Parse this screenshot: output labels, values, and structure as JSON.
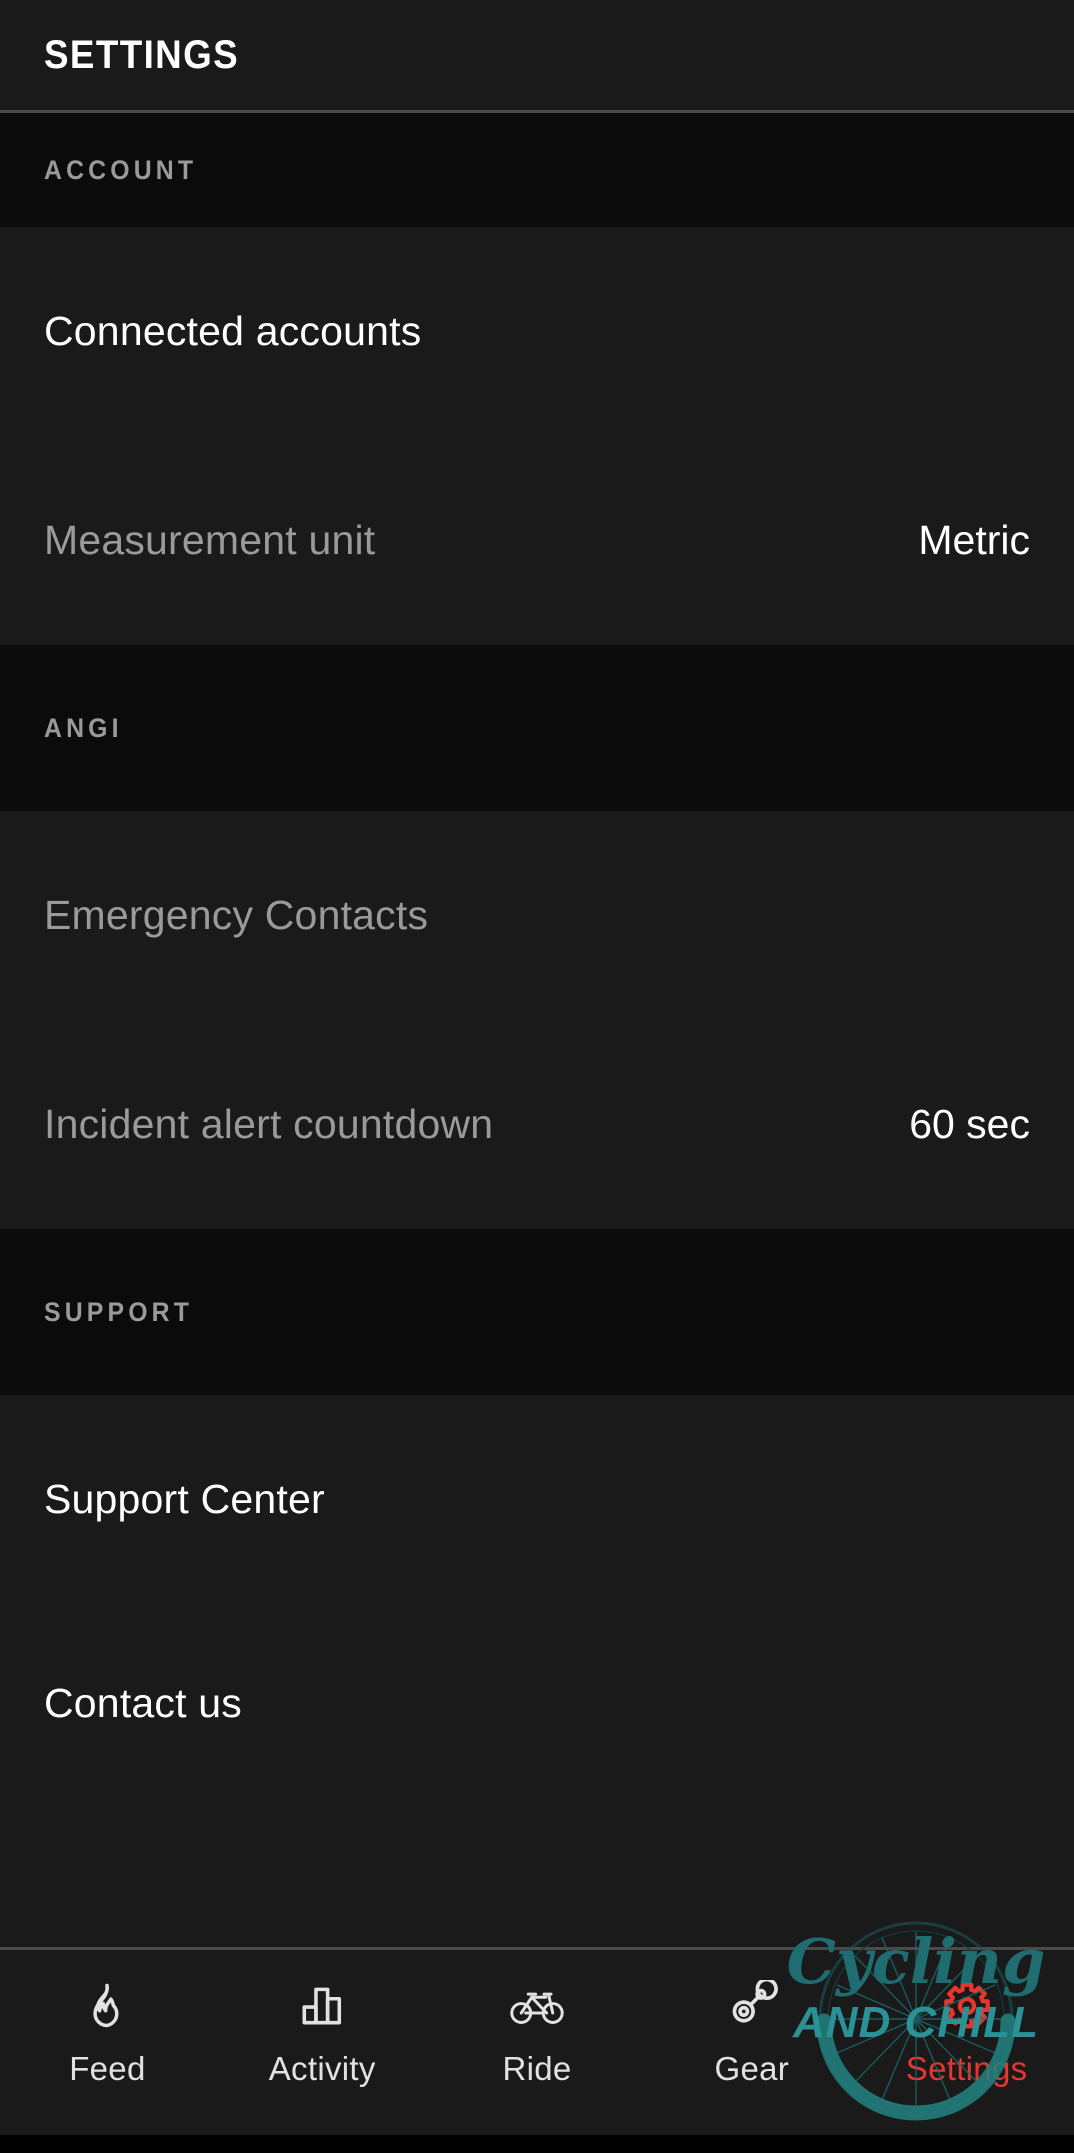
{
  "header": {
    "title": "SETTINGS"
  },
  "sections": [
    {
      "id": "account",
      "label": "ACCOUNT",
      "rows": [
        {
          "id": "connected-accounts",
          "label": "Connected accounts",
          "value": "",
          "state": "active"
        },
        {
          "id": "measurement-unit",
          "label": "Measurement unit",
          "value": "Metric",
          "state": "muted"
        }
      ]
    },
    {
      "id": "angi",
      "label": "ANGI",
      "rows": [
        {
          "id": "emergency-contacts",
          "label": "Emergency Contacts",
          "value": "",
          "state": "muted"
        },
        {
          "id": "incident-alert-countdown",
          "label": "Incident alert countdown",
          "value": "60 sec",
          "state": "muted"
        }
      ]
    },
    {
      "id": "support",
      "label": "SUPPORT",
      "rows": [
        {
          "id": "support-center",
          "label": "Support Center",
          "value": "",
          "state": "active"
        },
        {
          "id": "contact-us",
          "label": "Contact us",
          "value": "",
          "state": "active"
        }
      ]
    }
  ],
  "tabbar": {
    "active": "settings",
    "tabs": [
      {
        "id": "feed",
        "label": "Feed",
        "icon": "flame-icon"
      },
      {
        "id": "activity",
        "label": "Activity",
        "icon": "bar-chart-icon"
      },
      {
        "id": "ride",
        "label": "Ride",
        "icon": "bicycle-icon"
      },
      {
        "id": "gear",
        "label": "Gear",
        "icon": "chain-link-icon"
      },
      {
        "id": "settings",
        "label": "Settings",
        "icon": "gear-icon"
      }
    ]
  },
  "watermark": {
    "script_text": "Cycling",
    "bold_text": "AND CHILL"
  },
  "colors": {
    "background": "#1a1a1a",
    "section_background": "#0b0b0b",
    "divider": "#4a4a4a",
    "text_primary": "#ffffff",
    "text_muted": "#9a9a9a",
    "accent_active": "#e5372f",
    "watermark_teal": "#2a8f93",
    "watermark_teal_dark": "#17595c",
    "watermark_red": "#e5372f"
  }
}
